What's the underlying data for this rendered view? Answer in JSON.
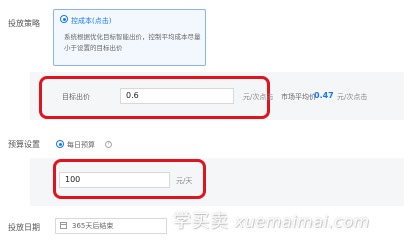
{
  "strategy": {
    "label": "投放策略",
    "option_title": "控成本(点击)",
    "option_desc": "系统根据优化目标智能出价，控制平均成本尽量小于设置的目标出价"
  },
  "target_bid": {
    "label": "目标出价",
    "value": "0.6",
    "unit": "元/次点击",
    "market_avg_label": "市场平均价",
    "market_avg_value": "0.47",
    "market_avg_unit": "元/次点击"
  },
  "budget": {
    "label": "预算设置",
    "option_label": "每日预算",
    "help_icon": "question-icon",
    "value": "100",
    "unit": "元/天"
  },
  "schedule": {
    "label": "投放日期",
    "value": "365天后结束",
    "icon": "calendar-icon"
  },
  "watermark": {
    "cn": "学买卖",
    "en": "xuemaimai.com"
  },
  "colors": {
    "accent": "#1677ff",
    "highlight": "#e0141e"
  }
}
